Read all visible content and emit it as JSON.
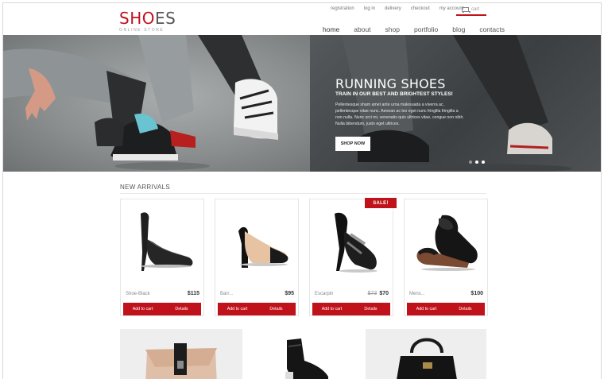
{
  "brand": {
    "logo_accent": "SHO",
    "logo_rest": "ES",
    "tagline": "ONLINE STORE"
  },
  "topbar": {
    "links": [
      "registration",
      "log in",
      "delivery",
      "checkout",
      "my account"
    ],
    "cart": "cart"
  },
  "nav": {
    "items": [
      "home",
      "about",
      "shop",
      "portfolio",
      "blog",
      "contacts"
    ],
    "active": "home"
  },
  "hero": {
    "title": "RUNNING SHOES",
    "subtitle": "TRAIN IN OUR BEST AND BRIGHTEST STYLES!",
    "text": "Pellentesque sham amet ante urna malesuada a viverra ac, pellentesque vitae nunc. Aenean ac leo eget nunc fringilla fringilla a non nulla. Nunc orci mi, venenatis quis ultrices vitae, congue non nibh. Nulla bibendum, justo eget ultrices.",
    "button": "SHOP NOW",
    "slides": 3,
    "active_slide": 2
  },
  "arrivals": {
    "title": "NEW ARRIVALS",
    "sale_badge": "SALE!",
    "add_label": "Add to cart",
    "details_label": "Details",
    "products": [
      {
        "name": "Shoe-Black",
        "price": "$115",
        "old_price": "",
        "on_sale": false
      },
      {
        "name": "Barr...",
        "price": "$95",
        "old_price": "",
        "on_sale": false
      },
      {
        "name": "Escarpin",
        "price": "$70",
        "old_price": "$73",
        "on_sale": true
      },
      {
        "name": "Mens...",
        "price": "$100",
        "old_price": "",
        "on_sale": false
      }
    ]
  },
  "colors": {
    "accent": "#c0121a"
  }
}
